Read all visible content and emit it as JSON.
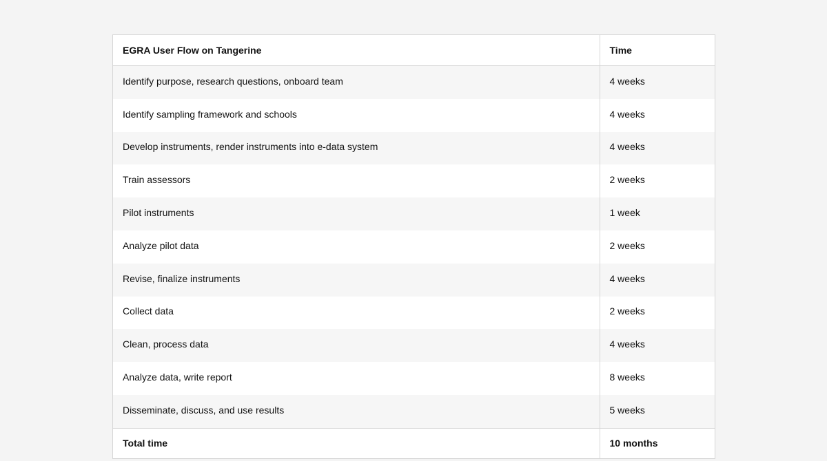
{
  "table": {
    "header": {
      "task": "EGRA User Flow on Tangerine",
      "time": "Time"
    },
    "rows": [
      {
        "task": "Identify purpose, research questions, onboard team",
        "time": "4 weeks"
      },
      {
        "task": "Identify sampling framework and schools",
        "time": "4 weeks"
      },
      {
        "task": "Develop instruments, render instruments into e-data system",
        "time": "4 weeks"
      },
      {
        "task": "Train assessors",
        "time": "2 weeks"
      },
      {
        "task": "Pilot instruments",
        "time": "1 week"
      },
      {
        "task": "Analyze pilot data",
        "time": "2 weeks"
      },
      {
        "task": "Revise, finalize instruments",
        "time": "4 weeks"
      },
      {
        "task": "Collect data",
        "time": "2 weeks"
      },
      {
        "task": "Clean, process data",
        "time": "4 weeks"
      },
      {
        "task": "Analyze data, write report",
        "time": "8 weeks"
      },
      {
        "task": "Disseminate, discuss, and use results",
        "time": "5 weeks"
      }
    ],
    "footer": {
      "task": "Total time",
      "time": "10 months"
    }
  }
}
